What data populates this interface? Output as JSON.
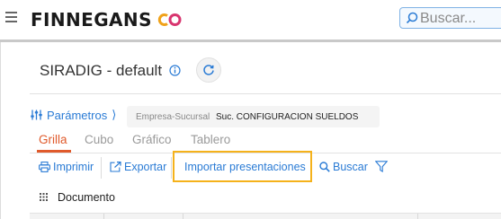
{
  "header": {
    "brand": "FINNEGANS",
    "search_placeholder": "Buscar...",
    "colors": {
      "accent_blue": "#2a7bd5",
      "active_tab": "#e05a2b",
      "highlight": "#f5b21b"
    },
    "icons": [
      "menu-icon",
      "finnegans-logo-icon",
      "search-icon"
    ]
  },
  "page": {
    "title": "SIRADIG - default",
    "icons": [
      "info-icon",
      "refresh-icon"
    ]
  },
  "params": {
    "label": "Parámetros",
    "chevron": "⟩",
    "filter": {
      "label": "Empresa-Sucursal",
      "value": "Suc. CONFIGURACION SUELDOS"
    }
  },
  "tabs": [
    {
      "label": "Grilla",
      "active": true
    },
    {
      "label": "Cubo",
      "active": false
    },
    {
      "label": "Gráfico",
      "active": false
    },
    {
      "label": "Tablero",
      "active": false
    }
  ],
  "toolbar": {
    "print": "Imprimir",
    "export": "Exportar",
    "import": "Importar presentaciones",
    "search": "Buscar",
    "highlighted": "import"
  },
  "grid": {
    "column_label": "Documento"
  }
}
